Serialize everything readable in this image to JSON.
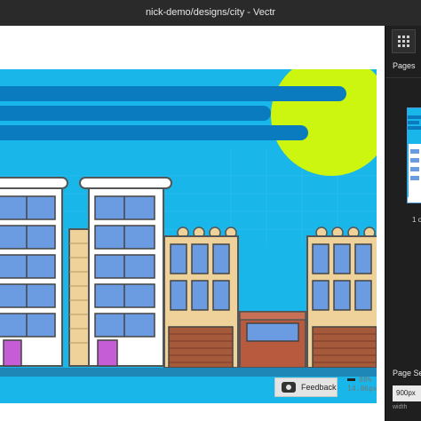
{
  "window": {
    "title": "nick-demo/designs/city - Vectr"
  },
  "panel": {
    "pages_label": "Pages",
    "page_count": "1 o",
    "page_settings_label": "Page Se",
    "width_value": "900px",
    "width_label": "width"
  },
  "footer": {
    "feedback_label": "Feedback",
    "zoom_percent": "88%",
    "zoom_size": "14.06px"
  },
  "icons": {
    "grid": "grid-icon",
    "feedback": "chat-bubble-icon"
  },
  "colors": {
    "sky": "#19b6ea",
    "sun": "#ccf50f",
    "stripe": "#0a7bbf",
    "ground": "#1f86b8",
    "window": "#6b9ce2",
    "tan_building": "#eed29a",
    "door": "#c45dd6",
    "brick": "#b85a3e",
    "garage": "#a55a3c"
  }
}
